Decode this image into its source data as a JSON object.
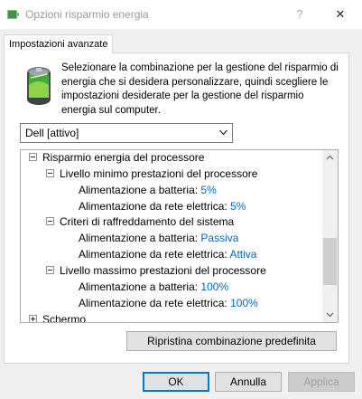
{
  "window": {
    "title": "Opzioni risparmio energia",
    "help_glyph": "?",
    "close_glyph": "✕"
  },
  "tab": {
    "label": "Impostazioni avanzate"
  },
  "description": "Selezionare la combinazione per la gestione del risparmio di energia che si desidera personalizzare, quindi scegliere le impostazioni desiderate per la gestione del risparmio energia sul computer.",
  "plan_select": {
    "value": "Dell [attivo]"
  },
  "tree": {
    "root": {
      "label": "Risparmio energia del processore"
    },
    "min_state": {
      "label": "Livello minimo prestazioni del processore",
      "battery_label": "Alimentazione a batteria:",
      "battery_value": "5%",
      "ac_label": "Alimentazione da rete elettrica:",
      "ac_value": "5%"
    },
    "cooling": {
      "label": "Criteri di raffreddamento del sistema",
      "battery_label": "Alimentazione a batteria:",
      "battery_value": "Passiva",
      "ac_label": "Alimentazione da rete elettrica:",
      "ac_value": "Attiva"
    },
    "max_state": {
      "label": "Livello massimo prestazioni del processore",
      "battery_label": "Alimentazione a batteria:",
      "battery_value": "100%",
      "ac_label": "Alimentazione da rete elettrica:",
      "ac_value": "100%"
    },
    "next": {
      "label": "Schermo"
    }
  },
  "buttons": {
    "restore": "Ripristina combinazione predefinita",
    "ok": "OK",
    "cancel": "Annulla",
    "apply": "Applica"
  },
  "colors": {
    "value_link": "#0066cc",
    "dialog_bg": "#f0f0f0",
    "focus_border": "#0078d7"
  }
}
